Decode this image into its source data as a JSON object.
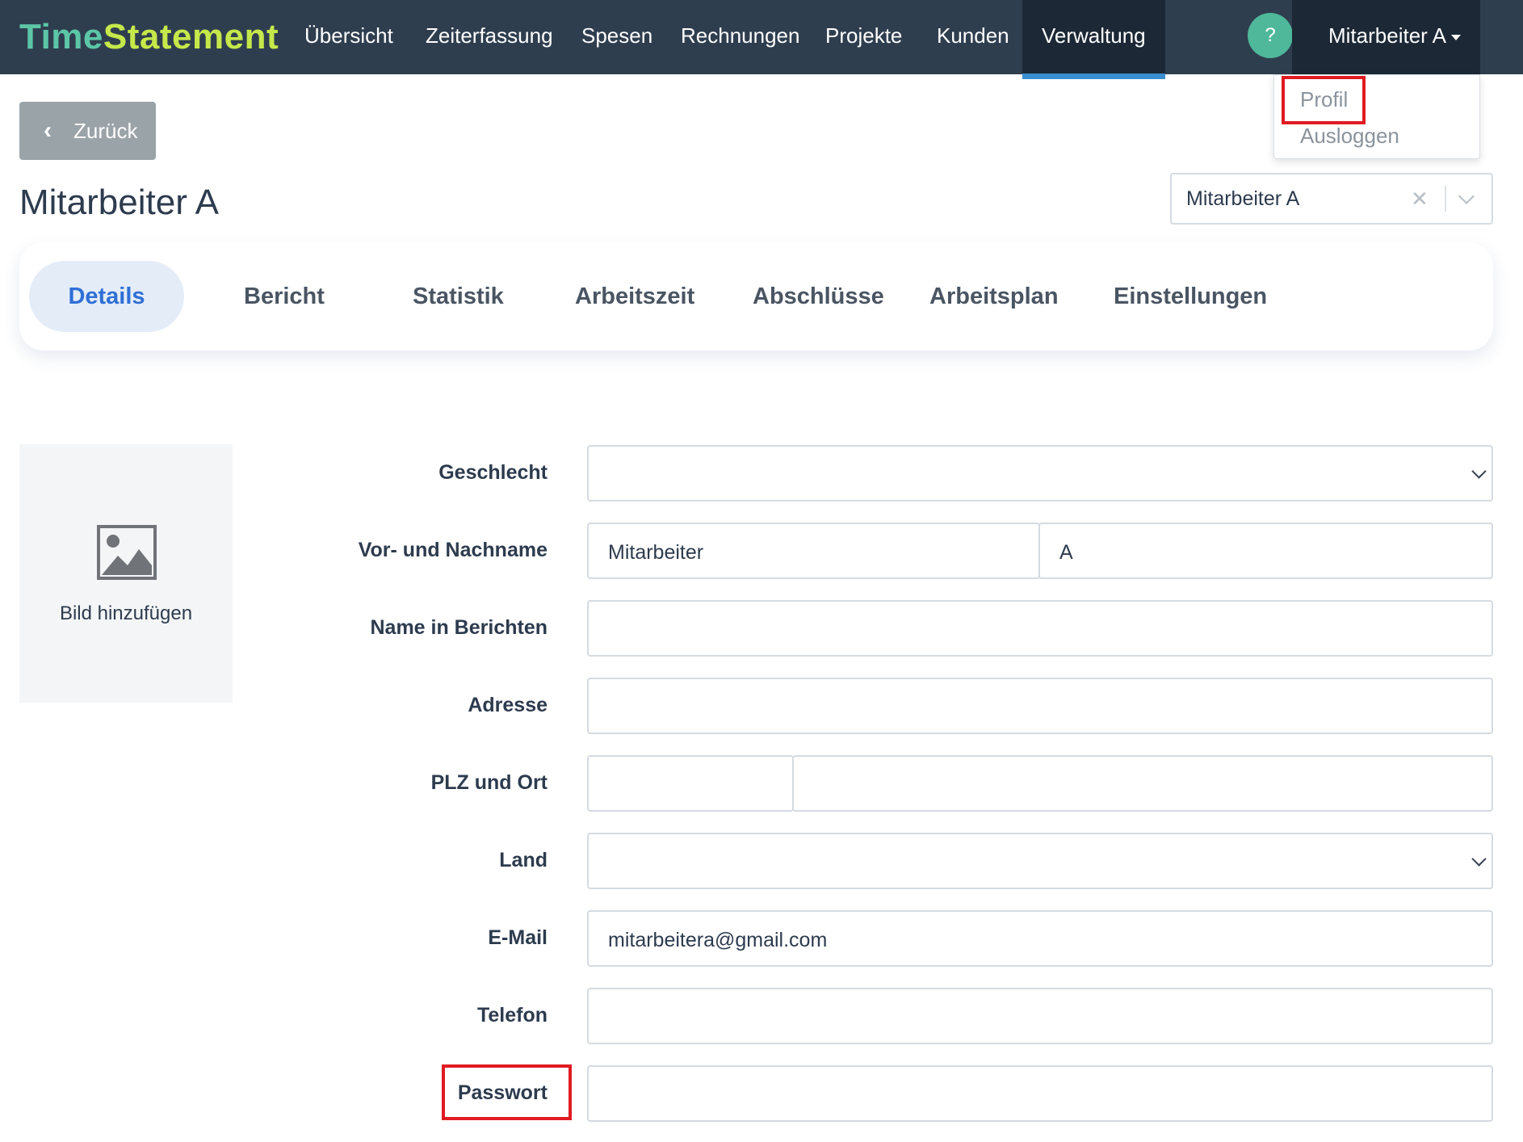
{
  "brand": {
    "part1": "Time",
    "part2": "Statement"
  },
  "nav": {
    "items": [
      {
        "label": "Übersicht"
      },
      {
        "label": "Zeiterfassung"
      },
      {
        "label": "Spesen"
      },
      {
        "label": "Rechnungen"
      },
      {
        "label": "Projekte"
      },
      {
        "label": "Kunden"
      },
      {
        "label": "Verwaltung",
        "active": true
      }
    ],
    "help_label": "?",
    "user_label": "Mitarbeiter A"
  },
  "user_dropdown": {
    "items": [
      "Profil",
      "Ausloggen"
    ],
    "highlighted": "Profil"
  },
  "back_button": {
    "label": "Zurück"
  },
  "page": {
    "title": "Mitarbeiter A"
  },
  "employee_select": {
    "value": "Mitarbeiter A",
    "clear_glyph": "✕"
  },
  "tabs": [
    {
      "label": "Details",
      "active": true
    },
    {
      "label": "Bericht"
    },
    {
      "label": "Statistik"
    },
    {
      "label": "Arbeitszeit"
    },
    {
      "label": "Abschlüsse"
    },
    {
      "label": "Arbeitsplan"
    },
    {
      "label": "Einstellungen"
    }
  ],
  "image_box": {
    "label": "Bild hinzufügen"
  },
  "form": {
    "gender": {
      "label": "Geschlecht",
      "value": ""
    },
    "name": {
      "label": "Vor- und Nachname",
      "first": "Mitarbeiter",
      "last": "A"
    },
    "report_name": {
      "label": "Name in Berichten",
      "value": ""
    },
    "address": {
      "label": "Adresse",
      "value": ""
    },
    "zip_city": {
      "label": "PLZ und Ort",
      "zip": "",
      "city": ""
    },
    "country": {
      "label": "Land",
      "value": ""
    },
    "email": {
      "label": "E-Mail",
      "value": "mitarbeitera@gmail.com"
    },
    "phone": {
      "label": "Telefon",
      "value": ""
    },
    "password": {
      "label": "Passwort",
      "value": ""
    }
  },
  "colors": {
    "navbar": "#2f3e4f",
    "accent": "#3a8fd0",
    "help": "#4fb89a",
    "highlight": "#e01b22",
    "tab_active": "#2e6fd6"
  }
}
